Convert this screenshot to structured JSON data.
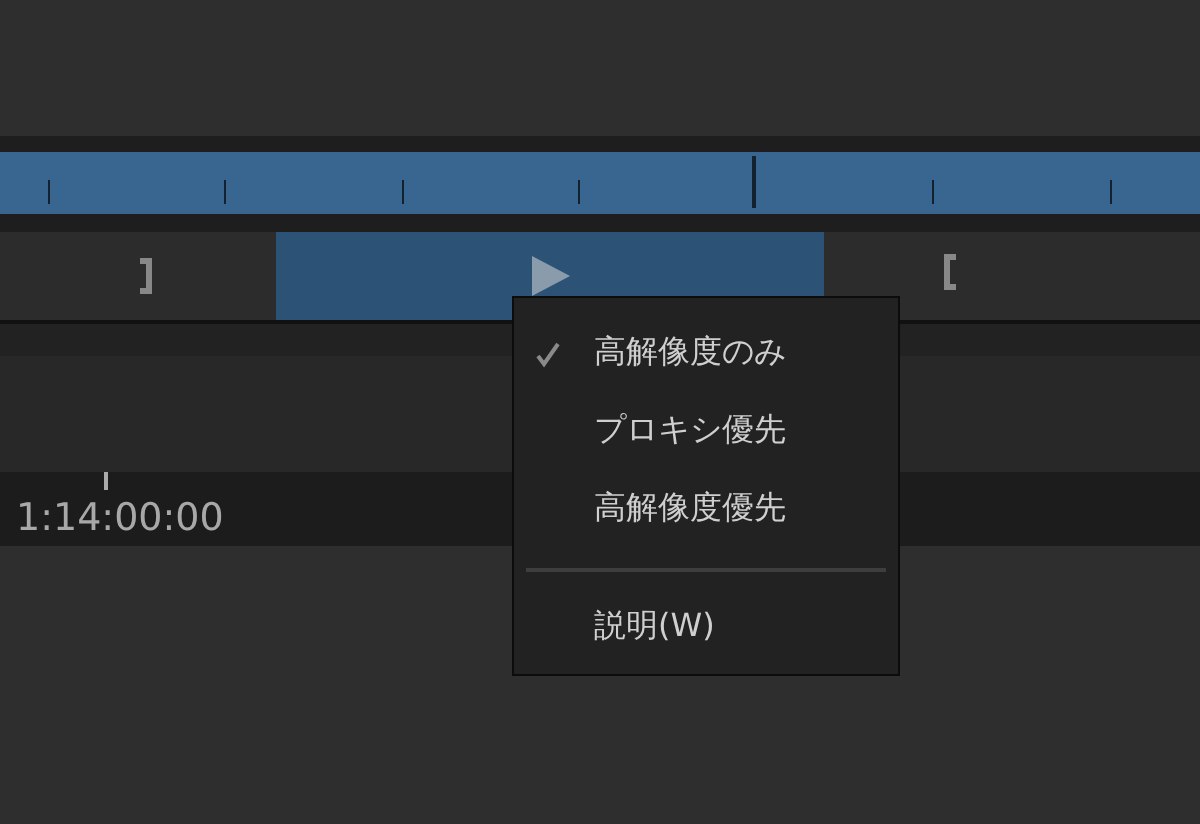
{
  "timecode": "1:14:00:00",
  "context_menu": {
    "items": [
      {
        "kind": "item",
        "label": "高解像度のみ",
        "checked": true
      },
      {
        "kind": "item",
        "label": "プロキシ優先",
        "checked": false
      },
      {
        "kind": "item",
        "label": "高解像度優先",
        "checked": false
      },
      {
        "kind": "separator"
      },
      {
        "kind": "item",
        "label": "説明(W)",
        "checked": false
      }
    ]
  }
}
